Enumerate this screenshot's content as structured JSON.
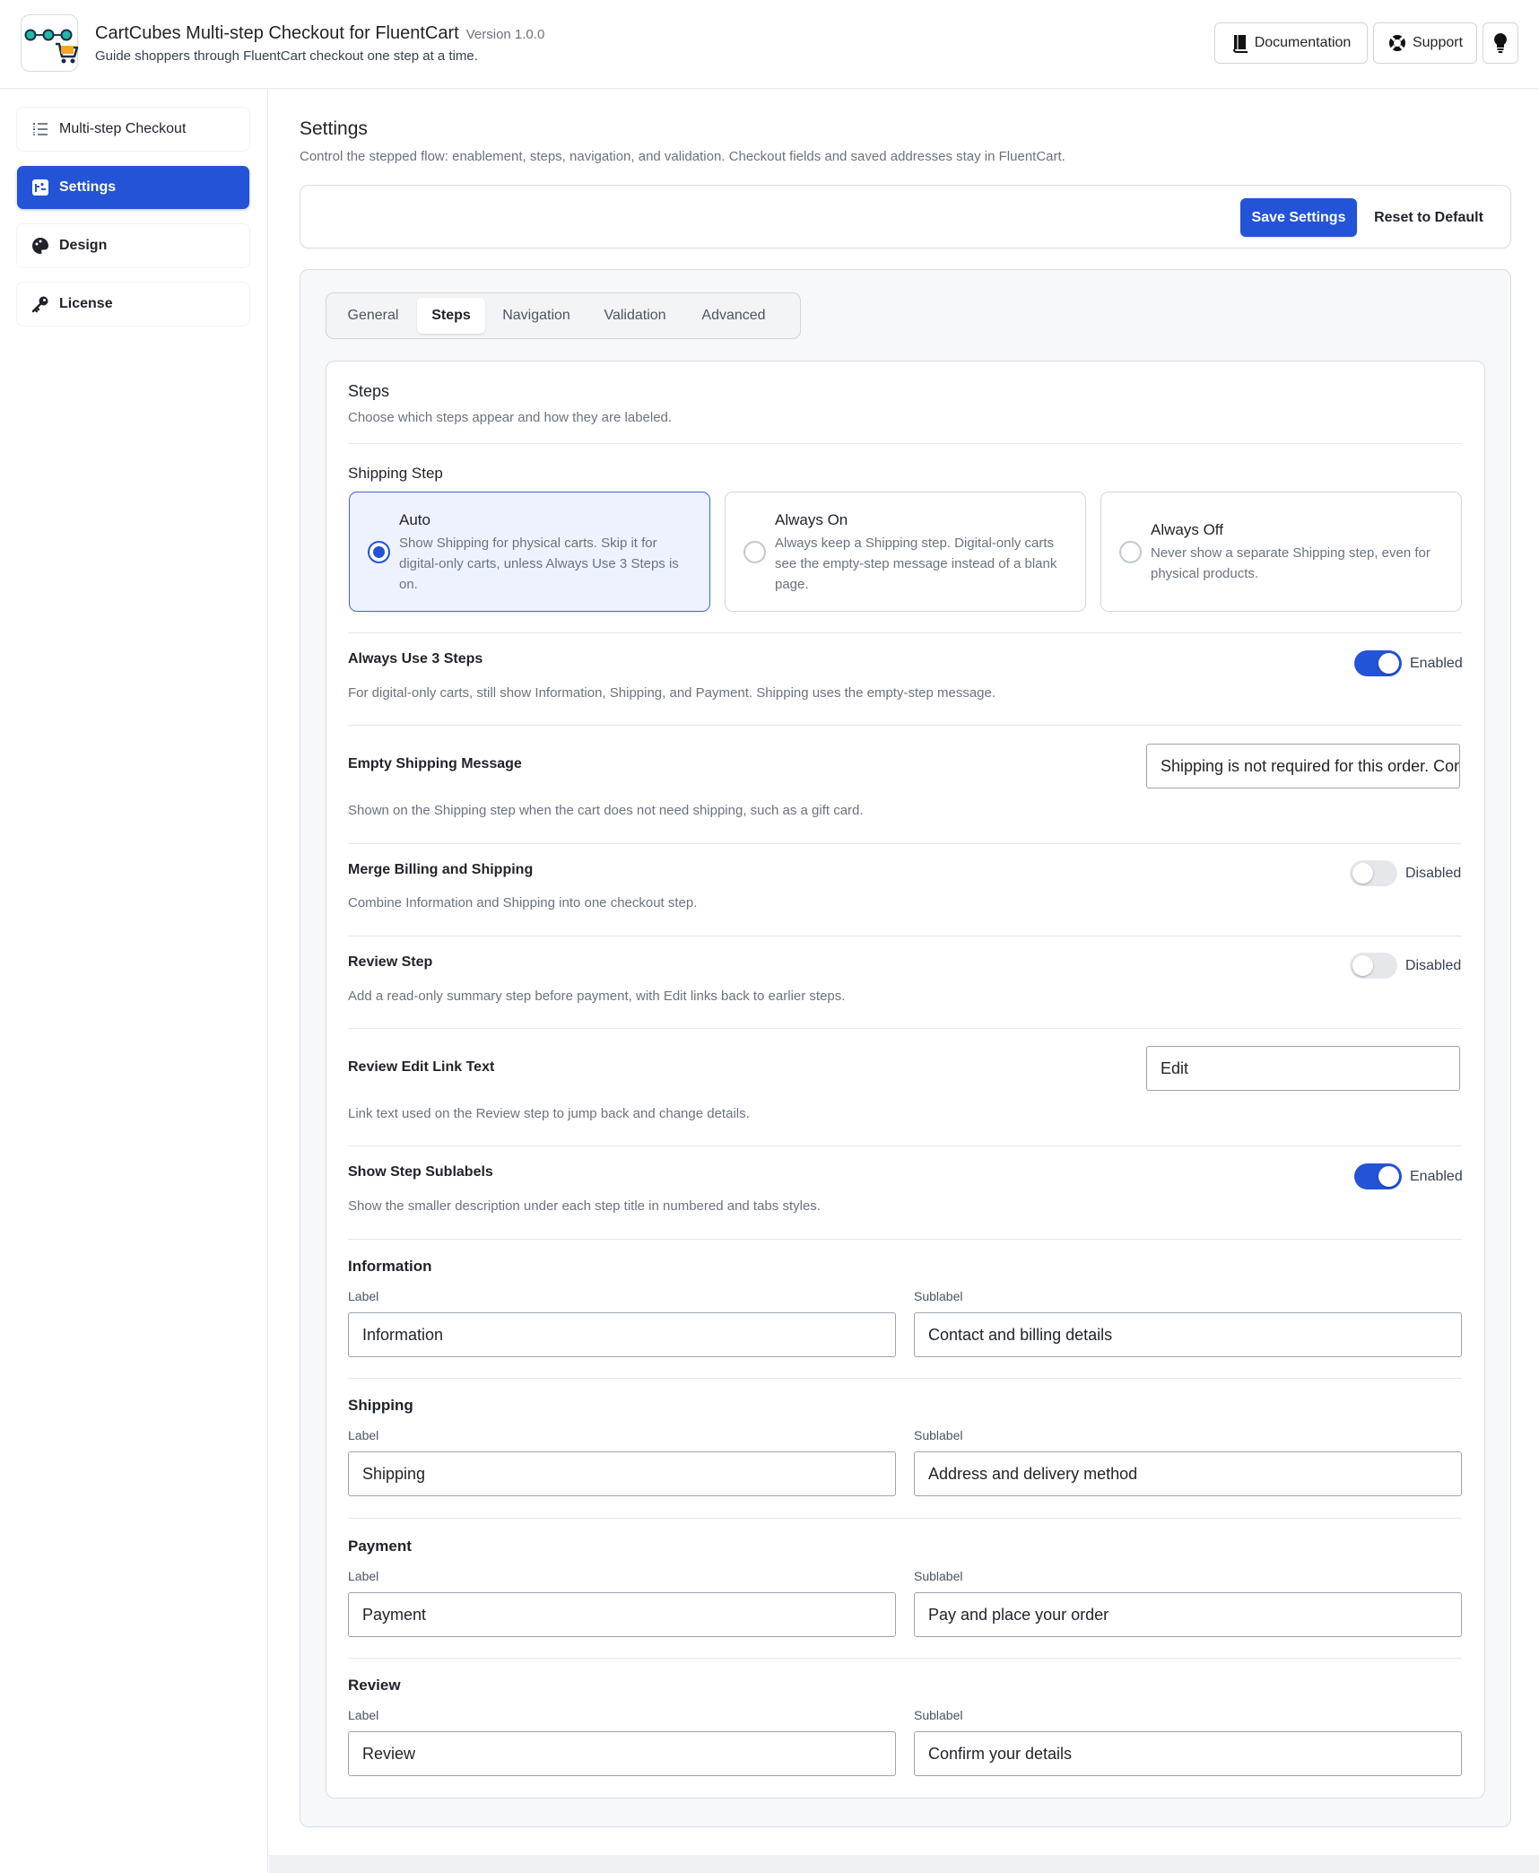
{
  "header": {
    "title": "CartCubes Multi-step Checkout for FluentCart",
    "version": "Version 1.0.0",
    "subtitle": "Guide shoppers through FluentCart checkout one step at a time.",
    "documentation_label": "Documentation",
    "support_label": "Support",
    "icons": {
      "logo": "cartcubes-logo",
      "documentation": "book-icon",
      "support": "lifebuoy-icon",
      "theme": "lightbulb-icon"
    }
  },
  "sidebar": {
    "items": [
      {
        "label": "Multi-step Checkout",
        "icon": "list-steps-icon",
        "active": false
      },
      {
        "label": "Settings",
        "icon": "settings-icon",
        "active": true
      },
      {
        "label": "Design",
        "icon": "palette-icon",
        "active": false
      },
      {
        "label": "License",
        "icon": "key-icon",
        "active": false
      }
    ]
  },
  "page": {
    "title": "Settings",
    "description": "Control the stepped flow: enablement, steps, navigation, and validation. Checkout fields and saved addresses stay in FluentCart."
  },
  "actions": {
    "save_label": "Save Settings",
    "reset_label": "Reset to Default"
  },
  "tabs": [
    {
      "label": "General",
      "active": false
    },
    {
      "label": "Steps",
      "active": true
    },
    {
      "label": "Navigation",
      "active": false
    },
    {
      "label": "Validation",
      "active": false
    },
    {
      "label": "Advanced",
      "active": false
    }
  ],
  "steps": {
    "title": "Steps",
    "description": "Choose which steps appear and how they are labeled.",
    "shipping_step": {
      "label": "Shipping Step",
      "selected": "Auto",
      "options": [
        {
          "title": "Auto",
          "description": "Show Shipping for physical carts. Skip it for digital-only carts, unless Always Use 3 Steps is on."
        },
        {
          "title": "Always On",
          "description": "Always keep a Shipping step. Digital-only carts see the empty-step message instead of a blank page."
        },
        {
          "title": "Always Off",
          "description": "Never show a separate Shipping step, even for physical products."
        }
      ]
    },
    "always_use_3_steps": {
      "label": "Always Use 3 Steps",
      "help": "For digital-only carts, still show Information, Shipping, and Payment. Shipping uses the empty-step message.",
      "state": "Enabled",
      "on": true
    },
    "empty_shipping_message": {
      "label": "Empty Shipping Message",
      "value": "Shipping is not required for this order. Continue to payment.",
      "help": "Shown on the Shipping step when the cart does not need shipping, such as a gift card."
    },
    "merge_billing_shipping": {
      "label": "Merge Billing and Shipping",
      "help": "Combine Information and Shipping into one checkout step.",
      "state": "Disabled",
      "on": false
    },
    "review_step": {
      "label": "Review Step",
      "help": "Add a read-only summary step before payment, with Edit links back to earlier steps.",
      "state": "Disabled",
      "on": false
    },
    "review_edit_link_text": {
      "label": "Review Edit Link Text",
      "value": "Edit",
      "help": "Link text used on the Review step to jump back and change details."
    },
    "show_step_sublabels": {
      "label": "Show Step Sublabels",
      "help": "Show the smaller description under each step title in numbered and tabs styles.",
      "state": "Enabled",
      "on": true
    },
    "label_caption": "Label",
    "sublabel_caption": "Sublabel",
    "step_labels": [
      {
        "group": "Information",
        "label": "Information",
        "sublabel": "Contact and billing details"
      },
      {
        "group": "Shipping",
        "label": "Shipping",
        "sublabel": "Address and delivery method"
      },
      {
        "group": "Payment",
        "label": "Payment",
        "sublabel": "Pay and place your order"
      },
      {
        "group": "Review",
        "label": "Review",
        "sublabel": "Confirm your details"
      }
    ]
  }
}
